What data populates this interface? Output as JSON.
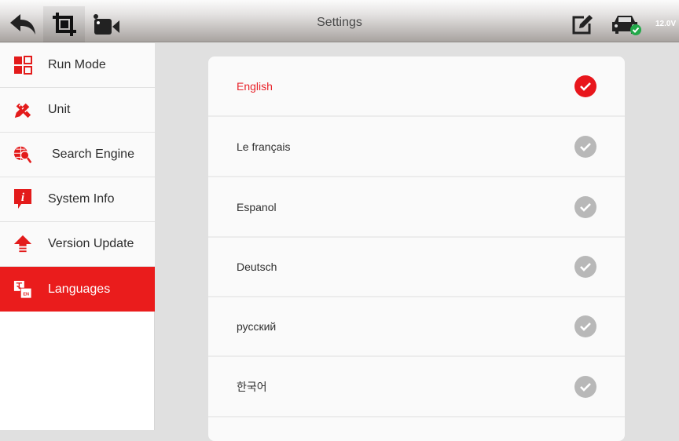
{
  "topbar": {
    "title": "Settings",
    "voltage": "12.0V",
    "icons": [
      "back-icon",
      "screenshot-crop-icon",
      "video-record-icon",
      "edit-note-icon",
      "vehicle-connected-icon"
    ]
  },
  "sidebar": {
    "items": [
      {
        "label": "Run Mode",
        "icon": "run-mode-icon",
        "active": false
      },
      {
        "label": "Unit",
        "icon": "unit-icon",
        "active": false
      },
      {
        "label": "Search Engine",
        "icon": "search-engine-icon",
        "active": false
      },
      {
        "label": "System Info",
        "icon": "system-info-icon",
        "active": false
      },
      {
        "label": "Version Update",
        "icon": "version-update-icon",
        "active": false
      },
      {
        "label": "Languages",
        "icon": "languages-icon",
        "active": true
      }
    ]
  },
  "languages": {
    "selected": "English",
    "items": [
      {
        "name": "English",
        "selected": true
      },
      {
        "name": "Le français",
        "selected": false
      },
      {
        "name": "Espanol",
        "selected": false
      },
      {
        "name": "Deutsch",
        "selected": false
      },
      {
        "name": "русский",
        "selected": false
      },
      {
        "name": "한국어",
        "selected": false
      }
    ]
  },
  "colors": {
    "accent": "#ea1c1c",
    "check_selected": "#e8161c",
    "check_unselected": "#b8b8b8"
  }
}
